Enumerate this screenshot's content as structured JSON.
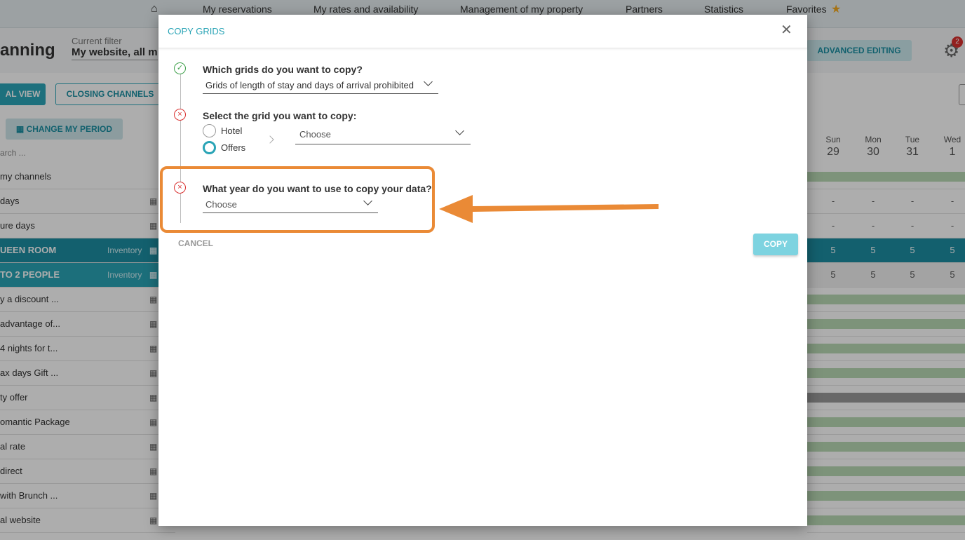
{
  "topnav": {
    "items": [
      "My reservations",
      "My rates and availability",
      "Management of my property",
      "Partners",
      "Statistics",
      "Favorites"
    ]
  },
  "header": {
    "title": "anning",
    "filter_label": "Current filter",
    "filter_value": "My website, all m",
    "advanced_editing": "ADVANCED EDITING",
    "notifications_count": "2"
  },
  "toolbar": {
    "view_button": "AL VIEW",
    "closing_channels": "CLOSING CHANNELS",
    "change_period": "CHANGE MY PERIOD",
    "search_placeholder": "arch ..."
  },
  "rows": [
    {
      "label": "my channels",
      "type": "plain"
    },
    {
      "label": "days",
      "type": "cal"
    },
    {
      "label": "ure days",
      "type": "cal"
    },
    {
      "label": "UEEN ROOM",
      "type": "room",
      "inventory": "Inventory"
    },
    {
      "label": "TO 2 PEOPLE",
      "type": "room2",
      "inventory": "Inventory"
    },
    {
      "label": "y a discount ...",
      "type": "cal"
    },
    {
      "label": "advantage of...",
      "type": "cal"
    },
    {
      "label": "4 nights for t...",
      "type": "cal"
    },
    {
      "label": "ax days Gift ...",
      "type": "cal"
    },
    {
      "label": "ty offer",
      "type": "cal"
    },
    {
      "label": "omantic Package",
      "type": "cal"
    },
    {
      "label": "al rate",
      "type": "cal"
    },
    {
      "label": " direct",
      "type": "cal"
    },
    {
      "label": " with Brunch ...",
      "type": "cal"
    },
    {
      "label": "al website",
      "type": "cal"
    }
  ],
  "calendar": {
    "days": [
      {
        "name": "Sun",
        "date": "29"
      },
      {
        "name": "Mon",
        "date": "30"
      },
      {
        "name": "Tue",
        "date": "31"
      },
      {
        "name": "Wed",
        "date": "1"
      }
    ],
    "dash": "-",
    "inventory_value": "5"
  },
  "dialog": {
    "title": "COPY GRIDS",
    "step1": {
      "label": "Which grids do you want to copy?",
      "value": "Grids of length of stay and days of arrival prohibited",
      "status": "ok"
    },
    "step2": {
      "label": "Select the grid you want to copy:",
      "options": [
        "Hotel",
        "Offers"
      ],
      "selected": "Offers",
      "select_value": "Choose",
      "status": "error"
    },
    "step3": {
      "label": "What year do you want to use to copy your data?",
      "value": "Choose",
      "status": "error"
    },
    "cancel": "CANCEL",
    "copy": "COPY"
  },
  "colors": {
    "accent": "#2aa4b6",
    "annotation": "#ea8a36",
    "ok": "#3da04a",
    "error": "#d9302f"
  }
}
